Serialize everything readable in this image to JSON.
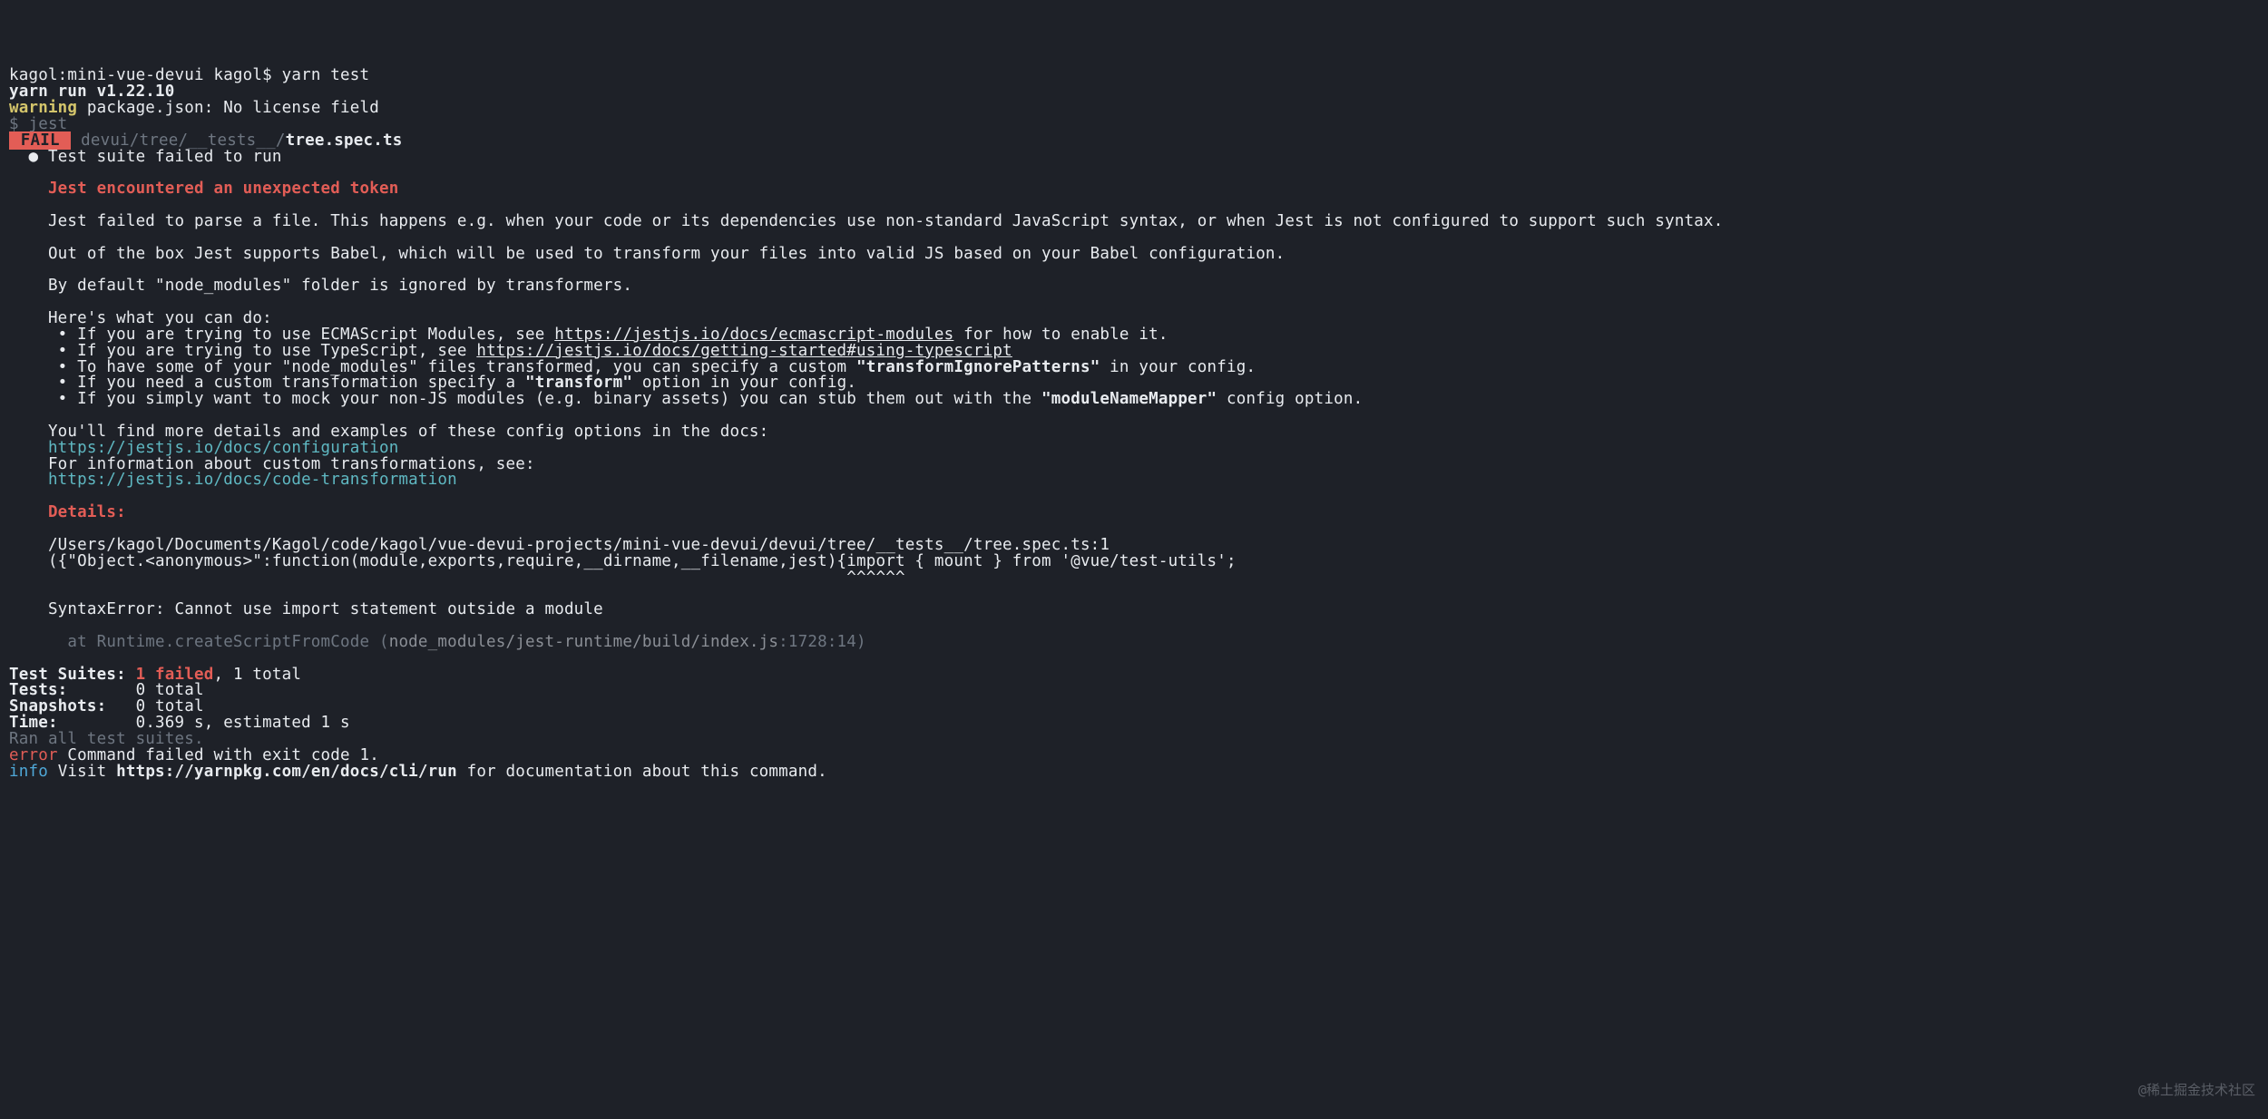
{
  "shell": {
    "prompt": "kagol:mini-vue-devui kagol$ ",
    "cmd": "yarn test"
  },
  "yarn_run": "yarn run v1.22.10",
  "warn_label": "warning",
  "warn_msg": " package.json: No license field",
  "jest_line": "$ jest",
  "fail_badge": " FAIL ",
  "fail_path_dim": " devui/tree/__tests__/",
  "fail_path_bold": "tree.spec.ts",
  "suite_bullet": "  ● ",
  "suite_fail": "Test suite failed to run",
  "blank": "",
  "err_heading": "    Jest encountered an unexpected token",
  "p1": "    Jest failed to parse a file. This happens e.g. when your code or its dependencies use non-standard JavaScript syntax, or when Jest is not configured to support such syntax.",
  "p2": "    Out of the box Jest supports Babel, which will be used to transform your files into valid JS based on your Babel configuration.",
  "p3": "    By default \"node_modules\" folder is ignored by transformers.",
  "p4": "    Here's what you can do:",
  "b1a": "     • If you are trying to use ECMAScript Modules, see ",
  "b1link": "https://jestjs.io/docs/ecmascript-modules",
  "b1b": " for how to enable it.",
  "b2a": "     • If you are trying to use TypeScript, see ",
  "b2link": "https://jestjs.io/docs/getting-started#using-typescript",
  "b3a": "     • To have some of your \"node_modules\" files transformed, you can specify a custom ",
  "b3bold": "\"transformIgnorePatterns\"",
  "b3b": " in your config.",
  "b4a": "     • If you need a custom transformation specify a ",
  "b4bold": "\"transform\"",
  "b4b": " option in your config.",
  "b5a": "     • If you simply want to mock your non-JS modules (e.g. binary assets) you can stub them out with the ",
  "b5bold": "\"moduleNameMapper\"",
  "b5b": " config option.",
  "more1": "    You'll find more details and examples of these config options in the docs:",
  "more1link": "    https://jestjs.io/docs/configuration",
  "more2": "    For information about custom transformations, see:",
  "more2link": "    https://jestjs.io/docs/code-transformation",
  "details_heading": "    Details:",
  "detail_path": "    /Users/kagol/Documents/Kagol/code/kagol/vue-devui-projects/mini-vue-devui/devui/tree/__tests__/tree.spec.ts:1",
  "detail_code": "    ({\"Object.<anonymous>\":function(module,exports,require,__dirname,__filename,jest){import { mount } from '@vue/test-utils';",
  "detail_caret": "                                                                                      ^^^^^^",
  "syntax_err": "    SyntaxError: Cannot use import statement outside a module",
  "stack_at": "      at Runtime.createScriptFromCode (",
  "stack_file": "node_modules/jest-runtime/build/index.js",
  "stack_loc": ":1728:14",
  "stack_close": ")",
  "summary": {
    "suites_label": "Test Suites: ",
    "suites_fail": "1 failed",
    "suites_rest": ", 1 total",
    "tests_label": "Tests:       ",
    "tests_val": "0 total",
    "snaps_label": "Snapshots:   ",
    "snaps_val": "0 total",
    "time_label": "Time:        ",
    "time_val": "0.369 s, estimated 1 s"
  },
  "ran_all": "Ran all test suites.",
  "err_label": "error",
  "err_msg": " Command failed with exit code 1.",
  "info_label": "info",
  "info_a": " Visit ",
  "info_link": "https://yarnpkg.com/en/docs/cli/run",
  "info_b": " for documentation about this command.",
  "watermark": "@稀土掘金技术社区"
}
